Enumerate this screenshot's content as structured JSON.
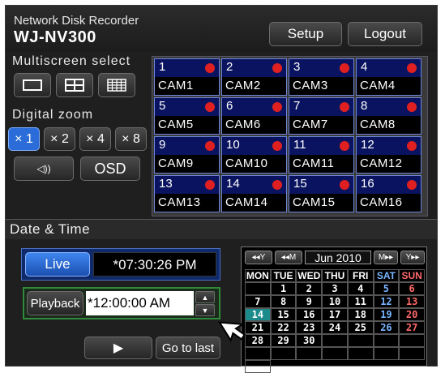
{
  "header": {
    "subtitle": "Network Disk Recorder",
    "model": "WJ-NV300",
    "setup_label": "Setup",
    "logout_label": "Logout"
  },
  "multiscreen": {
    "label": "Multiscreen select"
  },
  "zoom": {
    "label": "Digital zoom",
    "options": [
      "× 1",
      "× 2",
      "× 4",
      "× 8"
    ],
    "selected": "× 1"
  },
  "audio": {
    "icon": "speaker-icon",
    "glyph": "◁))"
  },
  "osd_label": "OSD",
  "cameras": [
    {
      "num": "1",
      "name": "CAM1"
    },
    {
      "num": "2",
      "name": "CAM2"
    },
    {
      "num": "3",
      "name": "CAM3"
    },
    {
      "num": "4",
      "name": "CAM4"
    },
    {
      "num": "5",
      "name": "CAM5"
    },
    {
      "num": "6",
      "name": "CAM6"
    },
    {
      "num": "7",
      "name": "CAM7"
    },
    {
      "num": "8",
      "name": "CAM8"
    },
    {
      "num": "9",
      "name": "CAM9"
    },
    {
      "num": "10",
      "name": "CAM10"
    },
    {
      "num": "11",
      "name": "CAM11"
    },
    {
      "num": "12",
      "name": "CAM12"
    },
    {
      "num": "13",
      "name": "CAM13"
    },
    {
      "num": "14",
      "name": "CAM14"
    },
    {
      "num": "15",
      "name": "CAM15"
    },
    {
      "num": "16",
      "name": "CAM16"
    }
  ],
  "datetime": {
    "title": "Date & Time",
    "live_label": "Live",
    "live_time": "*07:30:26 PM",
    "playback_label": "Playback",
    "playback_time": "*12:00:00 AM",
    "play_glyph": "▶",
    "goto_last_label": "Go to last"
  },
  "calendar": {
    "prev_year": "◂◂Y",
    "prev_month": "◂◂M",
    "month_label": "Jun 2010",
    "next_month": "M▸▸",
    "next_year": "Y▸▸",
    "weekdays": [
      "MON",
      "TUE",
      "WED",
      "THU",
      "FRI",
      "SAT",
      "SUN"
    ],
    "cells": [
      "",
      "1",
      "2",
      "3",
      "4",
      "5",
      "6",
      "7",
      "8",
      "9",
      "10",
      "11",
      "12",
      "13",
      "14",
      "15",
      "16",
      "17",
      "18",
      "19",
      "20",
      "21",
      "22",
      "23",
      "24",
      "25",
      "26",
      "27",
      "28",
      "29",
      "30",
      "",
      "",
      "",
      "",
      "",
      "",
      "",
      "",
      "",
      "",
      "",
      ""
    ],
    "highlighted": "14"
  },
  "colors": {
    "accent": "#2b6cd8",
    "camera_bg": "#0a1360",
    "record_dot": "#e02020",
    "playback_border": "#2f8a3a",
    "today": "#1a8a8a"
  }
}
